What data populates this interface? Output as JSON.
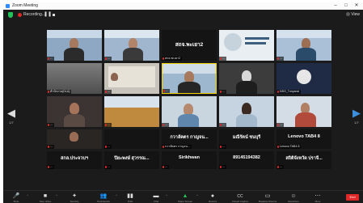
{
  "window": {
    "title": "Zoom Meeting",
    "minimize": "–",
    "maximize": "□",
    "close": "✕"
  },
  "topbar": {
    "recording_label": "Recording...",
    "view_label": "View"
  },
  "nav": {
    "left_arrow": "◀",
    "right_arrow": "▶",
    "left_page": "1/7",
    "right_page": "1/7"
  },
  "tiles": [
    {
      "name": "...",
      "big": ""
    },
    {
      "name": "...",
      "big": ""
    },
    {
      "name": "สถจ.พะเยา2",
      "big": "สถจ.พะเยา2"
    },
    {
      "name": "...",
      "big": ""
    },
    {
      "name": "...",
      "big": ""
    },
    {
      "name": "สำนักงาน(DLA)",
      "big": ""
    },
    {
      "name": "...",
      "big": ""
    },
    {
      "name": "...",
      "big": ""
    },
    {
      "name": "...",
      "big": ""
    },
    {
      "name": "NSO_Tunyarat",
      "big": ""
    },
    {
      "name": "...",
      "big": ""
    },
    {
      "name": "...",
      "big": ""
    },
    {
      "name": "...",
      "big": ""
    },
    {
      "name": "...",
      "big": ""
    },
    {
      "name": "...",
      "big": ""
    },
    {
      "name": "...",
      "big": ""
    },
    {
      "name": "...",
      "big": ""
    },
    {
      "name": "กวาลัคตร กาญจน...",
      "big": "กวาลัคตร กาญจน..."
    },
    {
      "name": "...",
      "big": "มณีรัตน์ ชนบุรี"
    },
    {
      "name": "Lenovo TAB4 8",
      "big": "Lenovo TAB4 8"
    },
    {
      "name": "...",
      "big": "สกล.ประจวบฯ"
    },
    {
      "name": "...",
      "big": "ปิยะพงษ์ สุวรรณ..."
    },
    {
      "name": "...",
      "big": "Sirikhwan"
    },
    {
      "name": "...",
      "big": "89145194382"
    },
    {
      "name": "...",
      "big": "สถิติจังหวัด ปราจี..."
    }
  ],
  "toolbar": {
    "items": [
      {
        "icon": "🎤",
        "label": "Mute"
      },
      {
        "icon": "■",
        "label": "Stop Video"
      },
      {
        "icon": "✦",
        "label": "Security"
      },
      {
        "icon": "👥",
        "label": "Participants"
      },
      {
        "icon": "▮▮",
        "label": "Polls"
      },
      {
        "icon": "▬",
        "label": "Chat"
      },
      {
        "icon": "▲",
        "label": "Share Screen"
      },
      {
        "icon": "●",
        "label": "Record"
      },
      {
        "icon": "CC",
        "label": "Closed Caption"
      },
      {
        "icon": "▭",
        "label": "Breakout Rooms"
      },
      {
        "icon": "☺",
        "label": "Reactions"
      },
      {
        "icon": "⋯",
        "label": "More"
      }
    ],
    "end_label": "End"
  }
}
